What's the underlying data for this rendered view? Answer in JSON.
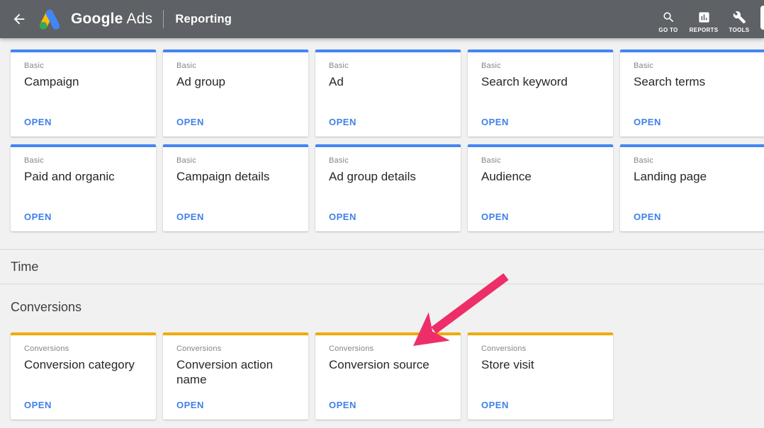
{
  "colors": {
    "header_bg": "#5e6165",
    "page_bg": "#f1f1f1",
    "basic_accent": "#4285f4",
    "conversions_accent": "#efab02",
    "open_link": "#4080e8",
    "arrow": "#ed2e68",
    "card_title": "#24272c",
    "card_category": "#80868b",
    "section_label": "#3c4043"
  },
  "header": {
    "brand_google": "Google",
    "brand_ads": "Ads",
    "page_title": "Reporting",
    "nav": [
      {
        "label": "GO TO",
        "icon": "search-icon"
      },
      {
        "label": "REPORTS",
        "icon": "reports-icon"
      },
      {
        "label": "TOOLS",
        "icon": "tools-icon"
      }
    ]
  },
  "sections": {
    "time_label": "Time",
    "conversions_label": "Conversions"
  },
  "cards": {
    "basic_row1": [
      {
        "category": "Basic",
        "title": "Campaign",
        "open_label": "OPEN"
      },
      {
        "category": "Basic",
        "title": "Ad group",
        "open_label": "OPEN"
      },
      {
        "category": "Basic",
        "title": "Ad",
        "open_label": "OPEN"
      },
      {
        "category": "Basic",
        "title": "Search keyword",
        "open_label": "OPEN"
      },
      {
        "category": "Basic",
        "title": "Search terms",
        "open_label": "OPEN"
      }
    ],
    "basic_row2": [
      {
        "category": "Basic",
        "title": "Paid and organic",
        "open_label": "OPEN"
      },
      {
        "category": "Basic",
        "title": "Campaign details",
        "open_label": "OPEN"
      },
      {
        "category": "Basic",
        "title": "Ad group details",
        "open_label": "OPEN"
      },
      {
        "category": "Basic",
        "title": "Audience",
        "open_label": "OPEN"
      },
      {
        "category": "Basic",
        "title": "Landing page",
        "open_label": "OPEN"
      }
    ],
    "conversions_row": [
      {
        "category": "Conversions",
        "title": "Conversion category",
        "open_label": "OPEN"
      },
      {
        "category": "Conversions",
        "title": "Conversion action name",
        "open_label": "OPEN"
      },
      {
        "category": "Conversions",
        "title": "Conversion source",
        "open_label": "OPEN"
      },
      {
        "category": "Conversions",
        "title": "Store visit",
        "open_label": "OPEN"
      }
    ]
  },
  "annotation": {
    "arrow_points_to": "Conversion source"
  }
}
